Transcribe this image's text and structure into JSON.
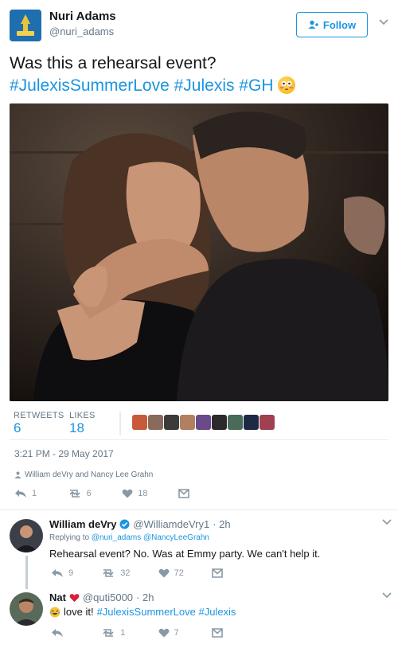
{
  "header": {
    "name": "Nuri Adams",
    "handle": "@nuri_adams",
    "follow_label": "Follow"
  },
  "tweet": {
    "text": "Was this a rehearsal event?",
    "tags": [
      "#JulexisSummerLove",
      "#Julexis",
      "#GH"
    ]
  },
  "stats": {
    "retweets_label": "RETWEETS",
    "retweets": "6",
    "likes_label": "LIKES",
    "likes": "18",
    "likers": [
      "#c85a3a",
      "#8a6a5a",
      "#3b3b3b",
      "#b08060",
      "#6a4a8a",
      "#2b2b2b",
      "#4a6a5a",
      "#1e2a44",
      "#a04050"
    ]
  },
  "meta": {
    "timestamp": "3:21 PM - 29 May 2017",
    "followed_by": "William deVry and Nancy Lee Grahn"
  },
  "actions": {
    "replies": "1",
    "retweets": "6",
    "likes": "18"
  },
  "replies": [
    {
      "name": "William deVry",
      "handle": "@WilliamdeVry1",
      "time": "· 2h",
      "replying_prefix": "Replying to",
      "replying_to": "@nuri_adams @NancyLeeGrahn",
      "text": "Rehearsal event? No. Was at Emmy party. We can't help it.",
      "replies": "9",
      "retweets": "32",
      "likes": "72"
    },
    {
      "name": "Nat",
      "handle": "@quti5000",
      "time": "· 2h",
      "text_plain": "love it!",
      "tags": "#JulexisSummerLove #Julexis",
      "replies": "",
      "retweets": "1",
      "likes": "7"
    }
  ],
  "colors": {
    "accent": "#1b95e0",
    "heart": "#e0245e"
  }
}
